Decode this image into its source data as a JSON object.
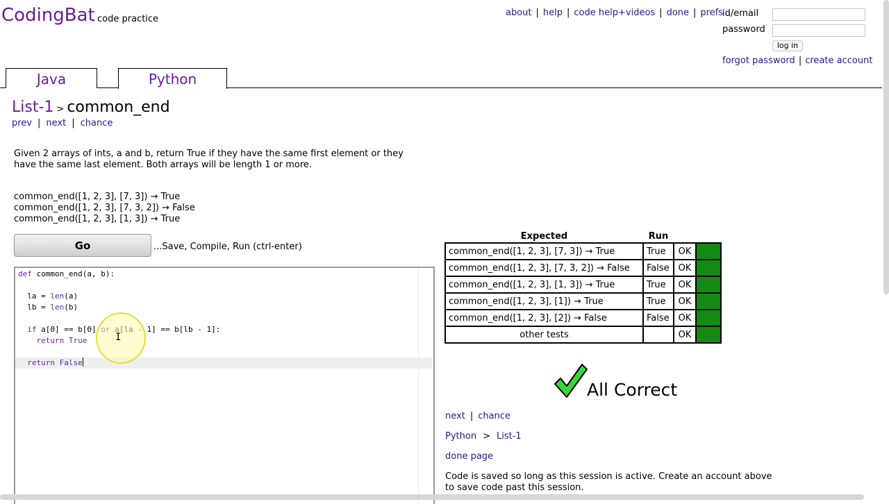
{
  "header": {
    "logo": "CodingBat",
    "tagline": "code practice",
    "nav": [
      "about",
      "help",
      "code help+videos",
      "done",
      "prefs"
    ]
  },
  "login": {
    "id_label": "id/email",
    "password_label": "password",
    "login_button": "log in",
    "forgot": "forgot password",
    "create": "create account"
  },
  "tabs": [
    "Java",
    "Python"
  ],
  "breadcrumb": {
    "category": "List-1",
    "separator": ">",
    "problem": "common_end"
  },
  "subnav": [
    "prev",
    "next",
    "chance"
  ],
  "description": "Given 2 arrays of ints, a and b, return True if they have the same first element or they have the same last element. Both arrays will be length 1 or more.",
  "examples": [
    "common_end([1, 2, 3], [7, 3]) → True",
    "common_end([1, 2, 3], [7, 3, 2]) → False",
    "common_end([1, 2, 3], [1, 3]) → True"
  ],
  "go": {
    "label": "Go",
    "hint": "...Save, Compile, Run (ctrl-enter)"
  },
  "code": {
    "l1_kw": "def",
    "l1_rest": " common_end(a, b):",
    "l3_a": "  la = ",
    "l3_b": "len",
    "l3_c": "(a)",
    "l4_a": "  lb = ",
    "l4_b": "len",
    "l4_c": "(b)",
    "l6_a": "  ",
    "l6_if": "if",
    "l6_b": " a[0] == b[0] ",
    "l6_or": "or",
    "l6_c": " a[la - 1] == b[lb - 1]:",
    "l7_a": "    ",
    "l7_ret": "return",
    "l7_val": " True",
    "l9_a": "  ",
    "l9_ret": "return",
    "l9_val": " False"
  },
  "results": {
    "headers": {
      "expected": "Expected",
      "run": "Run"
    },
    "rows": [
      {
        "expected": "common_end([1, 2, 3], [7, 3]) → True",
        "run": "True",
        "status": "OK"
      },
      {
        "expected": "common_end([1, 2, 3], [7, 3, 2]) → False",
        "run": "False",
        "status": "OK"
      },
      {
        "expected": "common_end([1, 2, 3], [1, 3]) → True",
        "run": "True",
        "status": "OK"
      },
      {
        "expected": "common_end([1, 2, 3], [1]) → True",
        "run": "True",
        "status": "OK"
      },
      {
        "expected": "common_end([1, 2, 3], [2]) → False",
        "run": "False",
        "status": "OK"
      }
    ],
    "other": {
      "expected": "other tests",
      "run": "",
      "status": "OK"
    },
    "pass_color": "#138a13"
  },
  "verdict": {
    "text": "All Correct",
    "icon": "checkmark-icon",
    "color": "#3bd63b"
  },
  "result_nav": [
    "next",
    "chance"
  ],
  "result_crumb": {
    "lang": "Python",
    "separator": ">",
    "category": "List-1"
  },
  "done_page": "done page",
  "saved_note": "Code is saved so long as this session is active. Create an account above to save code past this session."
}
